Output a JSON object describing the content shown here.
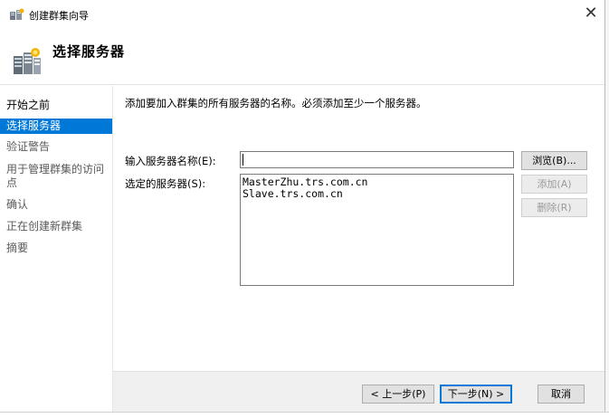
{
  "window": {
    "title": "创建群集向导",
    "close_glyph": "✕"
  },
  "header": {
    "title": "选择服务器"
  },
  "nav": {
    "items": [
      {
        "label": "开始之前",
        "state": "done"
      },
      {
        "label": "选择服务器",
        "state": "active"
      },
      {
        "label": "验证警告",
        "state": "pending"
      },
      {
        "label": "用于管理群集的访问点",
        "state": "pending"
      },
      {
        "label": "确认",
        "state": "pending"
      },
      {
        "label": "正在创建新群集",
        "state": "pending"
      },
      {
        "label": "摘要",
        "state": "pending"
      }
    ]
  },
  "main": {
    "instruction": "添加要加入群集的所有服务器的名称。必须添加至少一个服务器。",
    "server_name_label": "输入服务器名称(E):",
    "server_name_value": "",
    "selected_servers_label": "选定的服务器(S):",
    "selected_servers": [
      "MasterZhu.trs.com.cn",
      "Slave.trs.com.cn"
    ],
    "browse_label": "浏览(B)...",
    "add_label": "添加(A)",
    "remove_label": "删除(R)"
  },
  "footer": {
    "prev_label": "< 上一步(P)",
    "next_label": "下一步(N) >",
    "cancel_label": "取消"
  },
  "colors": {
    "accent": "#0078d7",
    "footer_bg": "#f0f0f0",
    "disabled_text": "#9a9a9a"
  },
  "icons": {
    "app": "cluster-wizard-icon",
    "header": "server-cluster-icon",
    "close": "close-icon"
  }
}
